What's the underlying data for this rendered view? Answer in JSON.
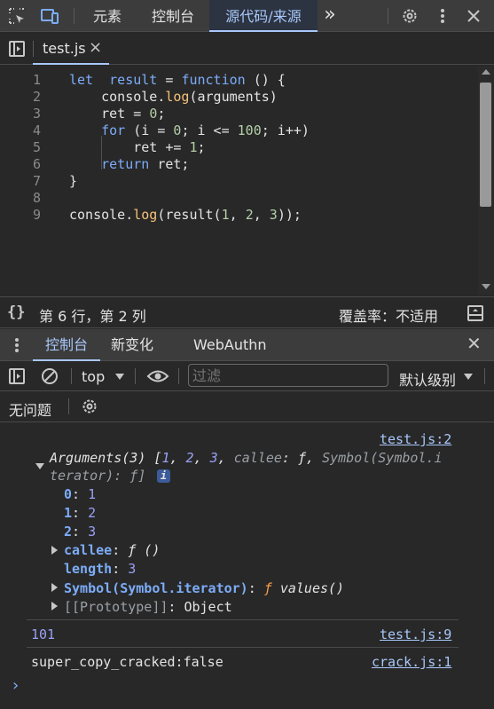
{
  "toolbar": {
    "tabs": [
      "元素",
      "控制台",
      "源代码/来源"
    ],
    "more": "»"
  },
  "file_tab": {
    "name": "test.js",
    "close": "×"
  },
  "editor": {
    "lines": [
      {
        "n": "1",
        "parts": [
          [
            "kw",
            "let"
          ],
          [
            "",
            "  "
          ],
          [
            "kw",
            "result"
          ],
          [
            "",
            " = "
          ],
          [
            "kw",
            "function"
          ],
          [
            "",
            " () {"
          ]
        ]
      },
      {
        "n": "2",
        "parts": [
          [
            "",
            "    console."
          ],
          [
            "fn",
            "log"
          ],
          [
            "",
            "(arguments)"
          ]
        ]
      },
      {
        "n": "3",
        "parts": [
          [
            "",
            "    ret = "
          ],
          [
            "num",
            "0"
          ],
          [
            "",
            ";"
          ]
        ]
      },
      {
        "n": "4",
        "parts": [
          [
            "",
            "    "
          ],
          [
            "kw",
            "for"
          ],
          [
            "",
            " (i = "
          ],
          [
            "num",
            "0"
          ],
          [
            "",
            "; i <= "
          ],
          [
            "num",
            "100"
          ],
          [
            "",
            "; i++)"
          ]
        ]
      },
      {
        "n": "5",
        "parts": [
          [
            "",
            "        ret += "
          ],
          [
            "num",
            "1"
          ],
          [
            "",
            ";"
          ]
        ]
      },
      {
        "n": "6",
        "parts": [
          [
            "",
            "    "
          ],
          [
            "kw",
            "return"
          ],
          [
            "",
            " ret;"
          ]
        ]
      },
      {
        "n": "7",
        "parts": [
          [
            "",
            "}"
          ]
        ]
      },
      {
        "n": "8",
        "parts": []
      },
      {
        "n": "9",
        "parts": [
          [
            "",
            "console."
          ],
          [
            "fn",
            "log"
          ],
          [
            "",
            "(result("
          ],
          [
            "num",
            "1"
          ],
          [
            "",
            ", "
          ],
          [
            "num",
            "2"
          ],
          [
            "",
            ", "
          ],
          [
            "num",
            "3"
          ],
          [
            "",
            "));"
          ]
        ]
      }
    ]
  },
  "status": {
    "braces": "{}",
    "position": "第 6 行，第 2 列",
    "coverage": "覆盖率：不适用"
  },
  "drawer": {
    "tabs": [
      "控制台",
      "新变化",
      "WebAuthn"
    ],
    "close": "✕"
  },
  "console_toolbar": {
    "context": "top",
    "filter_placeholder": "过滤",
    "level": "默认级别"
  },
  "issues": {
    "label": "无问题"
  },
  "console": {
    "link1": "test.js:2",
    "args_head1": "Arguments(3) [",
    "args_vals": [
      "1",
      "2",
      "3"
    ],
    "args_callee_key": "callee",
    "args_callee_val": "ƒ",
    "args_symbol": "Symbol(Symbol.i",
    "args_cont": "terator): ƒ]",
    "info_badge": "i",
    "idx": [
      [
        "0",
        "1"
      ],
      [
        "1",
        "2"
      ],
      [
        "2",
        "3"
      ]
    ],
    "callee_key": "callee",
    "callee_val": "ƒ ()",
    "length_key": "length",
    "length_val": "3",
    "symbol_key": "Symbol(Symbol.iterator)",
    "symbol_val_f": "ƒ",
    "symbol_val_name": "values()",
    "proto_key": "[[Prototype]]",
    "proto_val": "Object",
    "result_val": "101",
    "link2": "test.js:9",
    "crack_msg": "super_copy_cracked:false",
    "link3": "crack.js:1",
    "prompt": "›"
  },
  "colors": {
    "accent": "#a8c7fa",
    "keyword": "#7cacf8",
    "background": "#282828"
  }
}
